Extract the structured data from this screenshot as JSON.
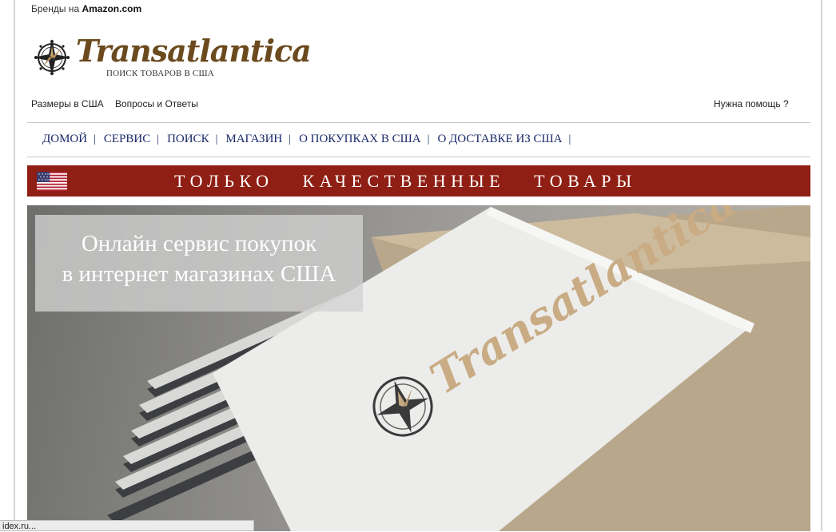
{
  "top_bar": {
    "prefix": "Бренды на",
    "brand": "Amazon.com"
  },
  "logo": {
    "name": "Transatlantica",
    "tagline": "ПОИСК ТОВАРОВ В США",
    "icon": "compass-rose-icon"
  },
  "sub_nav": {
    "items": [
      {
        "label": "Размеры в США"
      },
      {
        "label": "Вопросы и Ответы"
      }
    ],
    "help": "Нужна помощь ?"
  },
  "main_nav": {
    "items": [
      {
        "label": "ДОМОЙ"
      },
      {
        "label": "СЕРВИС"
      },
      {
        "label": "ПОИСК"
      },
      {
        "label": "МАГАЗИН"
      },
      {
        "label": "О ПОКУПКАХ В США"
      },
      {
        "label": "О ДОСТАВКЕ ИЗ США"
      }
    ],
    "separator": "|"
  },
  "banner": {
    "text": "ТОЛЬКО   КАЧЕСТВЕННЫЕ   ТОВАРЫ",
    "flag_icon": "us-flag-icon",
    "color": "#8f1f14"
  },
  "hero": {
    "caption_line1": "Онлайн сервис покупок",
    "caption_line2": "в интернет магазинах США",
    "card_text": "Transatlantica"
  },
  "status_bar": {
    "text": "idex.ru..."
  },
  "colors": {
    "nav": "#1c2a6a",
    "brand_brown": "#6b4a1e",
    "banner": "#8f1f14"
  }
}
